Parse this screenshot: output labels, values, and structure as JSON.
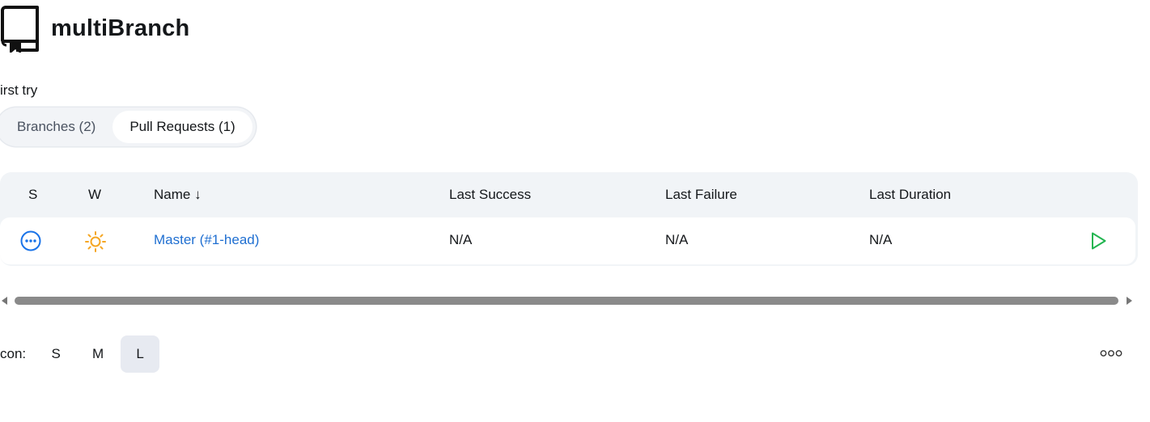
{
  "header": {
    "title": "multiBranch",
    "icon": "repo-bookmark-icon"
  },
  "description": "irst try",
  "tabs": [
    {
      "label": "Branches (2)",
      "active": false
    },
    {
      "label": "Pull Requests (1)",
      "active": true
    }
  ],
  "table": {
    "columns": {
      "status": "S",
      "weather": "W",
      "name": "Name ↓",
      "last_success": "Last Success",
      "last_failure": "Last Failure",
      "last_duration": "Last Duration"
    },
    "rows": [
      {
        "status_icon": "pending-dots-icon",
        "weather_icon": "sunny-icon",
        "name": "Master (#1-head)",
        "last_success": "N/A",
        "last_failure": "N/A",
        "last_duration": "N/A",
        "action_icon": "play-icon"
      }
    ]
  },
  "icon_size": {
    "label": "con:",
    "options": [
      "S",
      "M",
      "L"
    ],
    "selected": "L"
  },
  "colors": {
    "link": "#1f6fd1",
    "status_icon": "#1a73e8",
    "weather_icon": "#f5a623",
    "play_icon": "#22b550"
  }
}
